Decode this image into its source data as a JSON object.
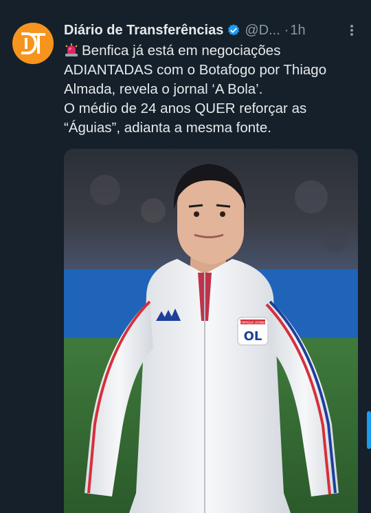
{
  "tweet": {
    "author_name": "Diário de Transferências",
    "author_handle": "@D...",
    "separator": "·",
    "time": "1h",
    "line1": "Benfica já está em negociações ADIANTADAS com o Botafogo por Thiago Almada, revela o jornal ‘A Bola’.",
    "line2": "O médio de 24 anos QUER reforçar as “Águias”, adianta a mesma fonte.",
    "avatar_logo_text": "DT",
    "emoji_icon": "police-siren-icon",
    "verified_icon": "verified-badge-icon",
    "more_icon": "more-vertical-icon"
  },
  "media": {
    "jacket_badge_text": "OL",
    "jacket_badge_small_text": "OLYMPIQUE LYONNAIS"
  },
  "colors": {
    "background": "#15202b",
    "accent": "#1d9bf0",
    "avatar": "#f7941d",
    "secondary_text": "#8b98a5",
    "primary_text": "#e7e9ea"
  }
}
